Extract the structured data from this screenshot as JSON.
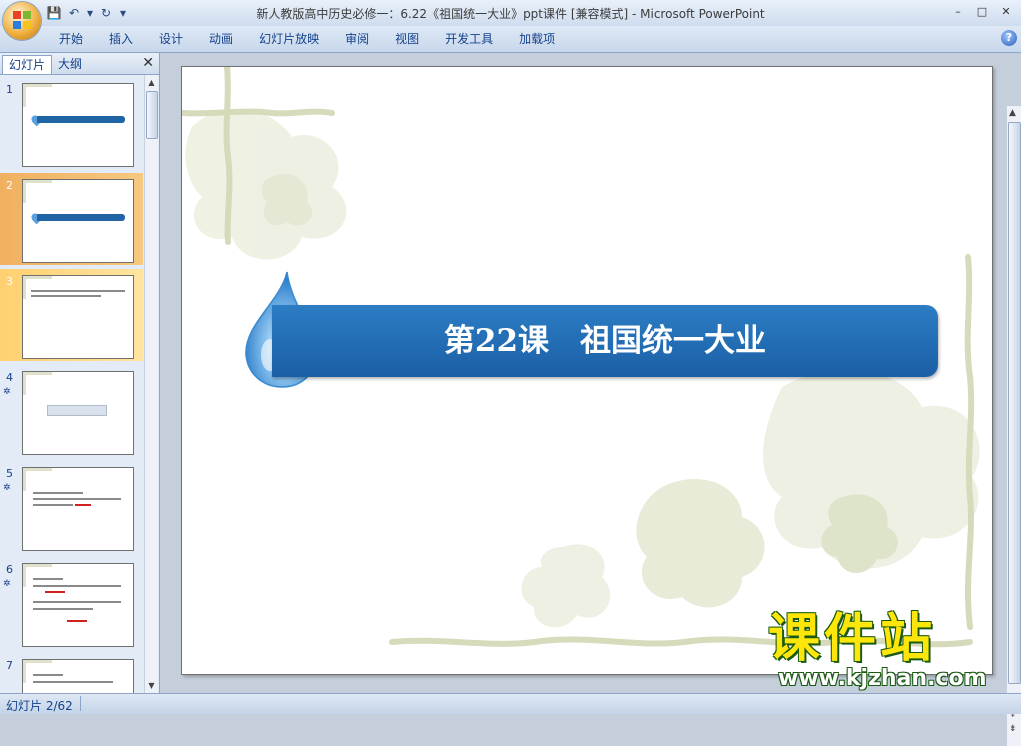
{
  "window": {
    "title": "新人教版高中历史必修一：6.22《祖国统一大业》ppt课件 [兼容模式] - Microsoft PowerPoint",
    "controls": {
      "minimize": "–",
      "maximize": "□",
      "close": "✕"
    }
  },
  "qat": {
    "save_icon": "💾",
    "undo_icon": "↶",
    "undo_dropdown": "▾",
    "redo_icon": "↻",
    "customize_icon": "▾"
  },
  "ribbon": {
    "tabs": [
      {
        "label": "开始"
      },
      {
        "label": "插入"
      },
      {
        "label": "设计"
      },
      {
        "label": "动画"
      },
      {
        "label": "幻灯片放映"
      },
      {
        "label": "审阅"
      },
      {
        "label": "视图"
      },
      {
        "label": "开发工具"
      },
      {
        "label": "加载项"
      }
    ],
    "help_icon": "?"
  },
  "slide_panel": {
    "tab_slides": "幻灯片",
    "tab_outline": "大纲",
    "close": "✕",
    "slides": [
      {
        "number": "1",
        "anim": ""
      },
      {
        "number": "2",
        "anim": ""
      },
      {
        "number": "3",
        "anim": ""
      },
      {
        "number": "4",
        "anim": "✲"
      },
      {
        "number": "5",
        "anim": "✲"
      },
      {
        "number": "6",
        "anim": "✲"
      },
      {
        "number": "7",
        "anim": ""
      }
    ],
    "scroll_up": "▲",
    "scroll_down": "▼"
  },
  "slide": {
    "title": "第22课　祖国统一大业"
  },
  "editor_scroll": {
    "up": "▲",
    "down": "▼",
    "prev_slide": "⇞",
    "next_slide": "⇟"
  },
  "watermark": {
    "cn": "课件站",
    "url": "www.kjzhan.com"
  },
  "status": {
    "slide_indicator": "幻灯片 2/62"
  }
}
